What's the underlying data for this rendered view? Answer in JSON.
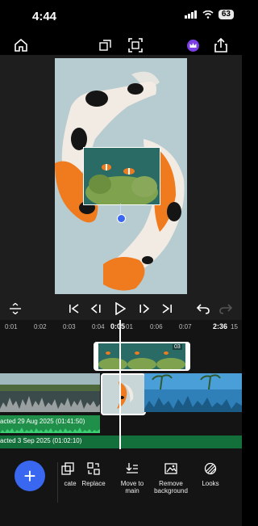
{
  "status": {
    "time": "4:44",
    "battery": "63"
  },
  "controls": {
    "current_time": "0:05",
    "end_time": "2:36"
  },
  "ruler": [
    "0:01",
    "0:02",
    "0:03",
    "0:04",
    "0:05",
    "01",
    "0:06",
    "0:07",
    "15"
  ],
  "overlay_clip": {
    "duration": "03"
  },
  "audio": [
    {
      "label": "acted 29 Aug 2025 (01:41:50)"
    },
    {
      "label": "acted 3 Sep 2025 (01:02:10)"
    }
  ],
  "toolbar": {
    "items": [
      {
        "label": "cate"
      },
      {
        "label": "Replace"
      },
      {
        "label": "Move to main"
      },
      {
        "label": "Remove background"
      },
      {
        "label": "Looks"
      }
    ]
  },
  "colors": {
    "accent": "#3a67f0",
    "premium": "#7b3fe4",
    "audio": "#1f8f4a"
  }
}
